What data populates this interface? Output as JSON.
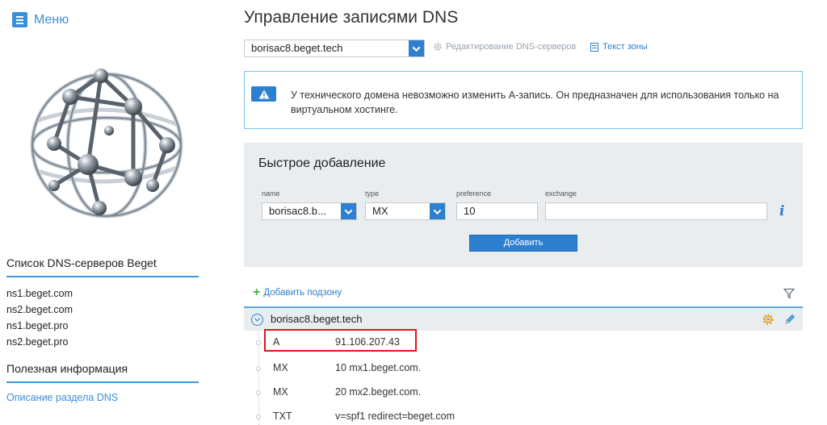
{
  "sidebar": {
    "menu_label": "Меню",
    "dns_servers_heading": "Список DNS-серверов Beget",
    "dns_servers": [
      "ns1.beget.com",
      "ns2.beget.com",
      "ns1.beget.pro",
      "ns2.beget.pro"
    ],
    "info_heading": "Полезная информация",
    "info_link": "Описание раздела DNS"
  },
  "main": {
    "title": "Управление записями DNS",
    "domain_selected": "borisac8.beget.tech",
    "edit_dns_label": "Редактирование DNS-серверов",
    "zone_text_label": "Текст зоны",
    "alert_text": "У технического домена невозможно изменить A-запись. Он предназначен для использования только на виртуальном хостинге."
  },
  "quick_add": {
    "title": "Быстрое добавление",
    "fields": {
      "name_label": "name",
      "name_value": "borisac8.b...",
      "type_label": "type",
      "type_value": "MX",
      "preference_label": "preference",
      "preference_value": "10",
      "exchange_label": "exchange",
      "exchange_value": ""
    },
    "add_button": "Добавить"
  },
  "records": {
    "add_subzone": "Добавить подзону",
    "zone_name": "borisac8.beget.tech",
    "items": [
      {
        "type": "A",
        "value": "91.106.207.43"
      },
      {
        "type": "MX",
        "value": "10 mx1.beget.com."
      },
      {
        "type": "MX",
        "value": "20 mx2.beget.com."
      },
      {
        "type": "TXT",
        "value": "v=spf1 redirect=beget.com"
      }
    ]
  },
  "colors": {
    "accent": "#2d7fd0",
    "panel_bg": "#e9edf0",
    "highlight_border": "#e0141e",
    "plus_green": "#4caf3b"
  }
}
